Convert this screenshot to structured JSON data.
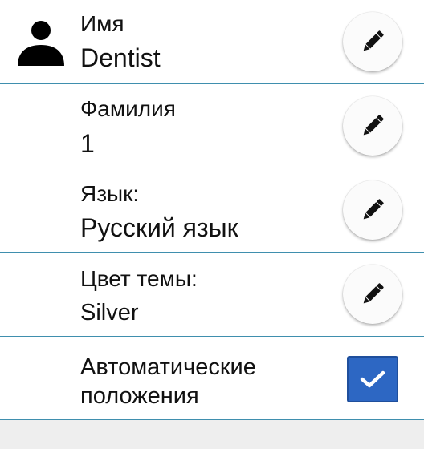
{
  "settings": {
    "first_name": {
      "label": "Имя",
      "value": "Dentist",
      "edit_icon": "pencil-icon"
    },
    "last_name": {
      "label": "Фамилия",
      "value": "1",
      "edit_icon": "pencil-icon"
    },
    "language": {
      "label": "Язык:",
      "value": "Русский язык",
      "edit_icon": "pencil-icon"
    },
    "theme_color": {
      "label": "Цвет темы:",
      "value": "Silver",
      "edit_icon": "pencil-icon"
    },
    "auto_positions": {
      "label_line1": "Автоматические",
      "label_line2": "положения",
      "checked": true
    }
  },
  "colors": {
    "divider": "#3f8fae",
    "checkbox": "#2d67c3",
    "footer": "#eeeeee"
  },
  "icons": {
    "avatar": "user-silhouette-icon",
    "check": "checkmark-icon"
  }
}
